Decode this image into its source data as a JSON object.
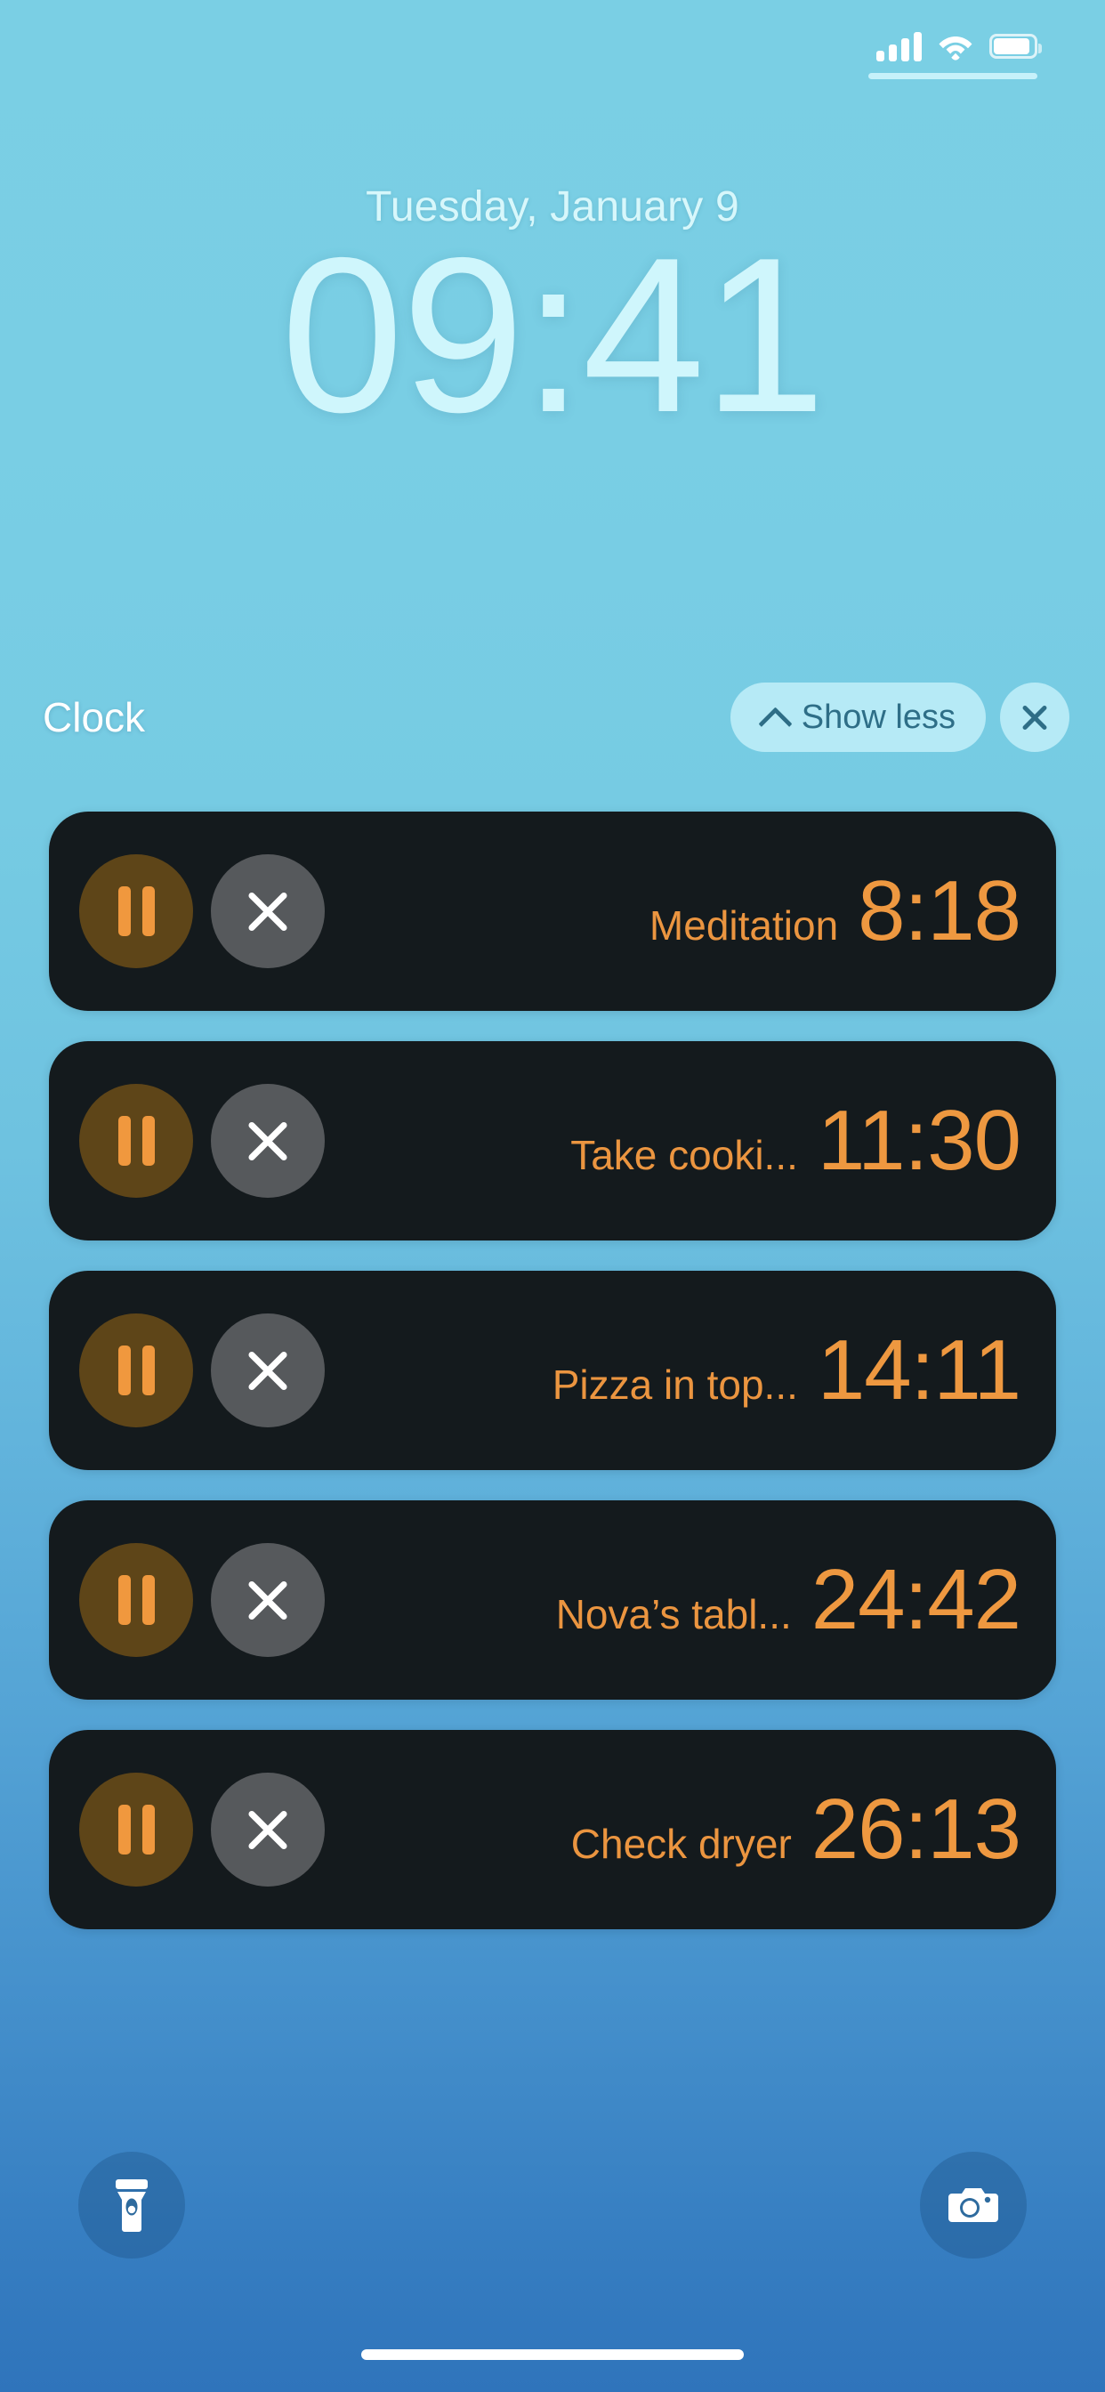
{
  "status_bar": {
    "cellular_icon": "signal-bars-icon",
    "wifi_icon": "wifi-icon",
    "battery_icon": "battery-icon",
    "battery_level_percent": 92
  },
  "lock_screen": {
    "date": "Tuesday, January 9",
    "time": "09:41",
    "date_color": "#D7F7FB",
    "time_color": "#CFF6FC"
  },
  "widget": {
    "app_name": "Clock",
    "show_less_label": "Show less",
    "collapse_icon": "chevron-up-icon",
    "close_icon": "close-icon",
    "pill_bg_color": "#D2F6FD",
    "pill_text_color": "#2E6E87"
  },
  "timers": {
    "card_bg_color": "#141A1D",
    "accent_color": "#EE9840",
    "pause_circle_color": "#5E4518",
    "stop_circle_color": "#56595C",
    "pause_icon": "pause-icon",
    "stop_icon": "close-icon",
    "items": [
      {
        "label": "Meditation",
        "time": "8:18"
      },
      {
        "label": "Take cooki...",
        "time": "11:30"
      },
      {
        "label": "Pizza in top...",
        "time": "14:11"
      },
      {
        "label": "Nova’s tabl...",
        "time": "24:42"
      },
      {
        "label": "Check dryer",
        "time": "26:13"
      }
    ]
  },
  "quick_actions": {
    "flashlight_icon": "flashlight-icon",
    "camera_icon": "camera-icon"
  },
  "home_indicator": "home-indicator"
}
